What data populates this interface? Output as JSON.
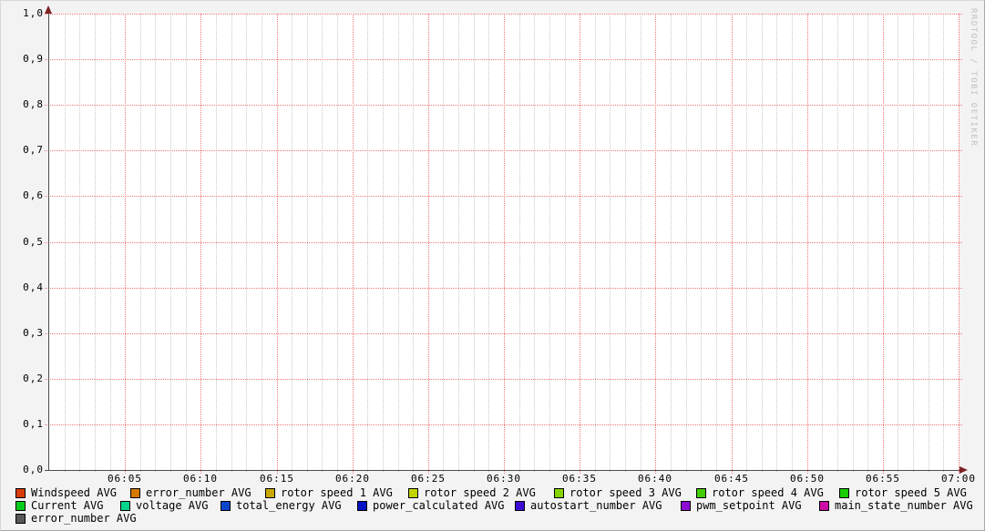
{
  "watermark": "RRDTOOL / TOBI OETIKER",
  "colors": {
    "background": "#f3f3f3",
    "canvas": "#ffffff",
    "grid_minor": "#c9c9c9",
    "grid_major": "#ef7878",
    "axis": "#4d4d4d",
    "arrow": "#7e2222",
    "text": "#000000",
    "watermark_text": "#c0c0c0"
  },
  "chart_data": {
    "type": "line",
    "title": "",
    "xlabel": "",
    "ylabel": "",
    "x_axis": {
      "start": "06:00",
      "end": "07:00",
      "total_minutes": 60,
      "minor_step_minutes": 1,
      "major_step_minutes": 5,
      "tick_labels": [
        "06:05",
        "06:10",
        "06:15",
        "06:20",
        "06:25",
        "06:30",
        "06:35",
        "06:40",
        "06:45",
        "06:50",
        "06:55",
        "07:00"
      ]
    },
    "y_axis": {
      "min": 0,
      "max": 1,
      "major_step": 0.1,
      "tick_labels_top_to_bottom": [
        "1,0",
        "0,9",
        "0,8",
        "0,7",
        "0,6",
        "0,5",
        "0,4",
        "0,3",
        "0,2",
        "0,1",
        "0,0"
      ]
    },
    "grid": true,
    "legend_position": "bottom",
    "series": [
      {
        "name": "Windspeed AVG",
        "color": "#d93d0a",
        "values": []
      },
      {
        "name": "error_number AVG",
        "color": "#d47800",
        "values": []
      },
      {
        "name": "rotor speed 1 AVG",
        "color": "#c8a800",
        "values": []
      },
      {
        "name": "rotor speed 2 AVG",
        "color": "#c2d400",
        "values": []
      },
      {
        "name": "rotor speed 3 AVG",
        "color": "#86d400",
        "values": []
      },
      {
        "name": "rotor speed 4 AVG",
        "color": "#46cc04",
        "values": []
      },
      {
        "name": "rotor speed 5 AVG",
        "color": "#1acc04",
        "values": []
      },
      {
        "name": "Current AVG",
        "color": "#04cc1c",
        "values": []
      },
      {
        "name": "voltage AVG",
        "color": "#04d48c",
        "values": []
      },
      {
        "name": "total_energy AVG",
        "color": "#0c46cc",
        "values": []
      },
      {
        "name": "power_calculated AVG",
        "color": "#0414c4",
        "values": []
      },
      {
        "name": "autostart_number AVG",
        "color": "#3c0cd4",
        "values": []
      },
      {
        "name": "pwm_setpoint AVG",
        "color": "#8c0cd4",
        "values": []
      },
      {
        "name": "main_state_number AVG",
        "color": "#cc0ca4",
        "values": []
      },
      {
        "name": "error_number AVG",
        "color": "#585858",
        "values": []
      }
    ]
  },
  "legend": {
    "rows": [
      [
        {
          "label": "Windspeed AVG",
          "color": "#d93d0a"
        },
        {
          "label": "error_number AVG",
          "color": "#d47800"
        },
        {
          "label": "rotor speed 1 AVG",
          "color": "#c8a800"
        },
        {
          "label": "rotor speed 2 AVG",
          "color": "#c2d400"
        },
        {
          "label": "rotor speed 3 AVG",
          "color": "#86d400"
        },
        {
          "label": "rotor speed 4 AVG",
          "color": "#46cc04"
        },
        {
          "label": "rotor speed 5 AVG",
          "color": "#1acc04"
        }
      ],
      [
        {
          "label": "Current AVG",
          "color": "#04cc1c"
        },
        {
          "label": "voltage AVG",
          "color": "#04d48c"
        },
        {
          "label": "total_energy AVG",
          "color": "#0c46cc"
        },
        {
          "label": "power_calculated AVG",
          "color": "#0414c4"
        },
        {
          "label": "autostart_number AVG",
          "color": "#3c0cd4"
        },
        {
          "label": "pwm_setpoint AVG",
          "color": "#8c0cd4"
        },
        {
          "label": "main_state_number AVG",
          "color": "#cc0ca4"
        }
      ],
      [
        {
          "label": "error_number AVG",
          "color": "#585858"
        }
      ]
    ]
  }
}
